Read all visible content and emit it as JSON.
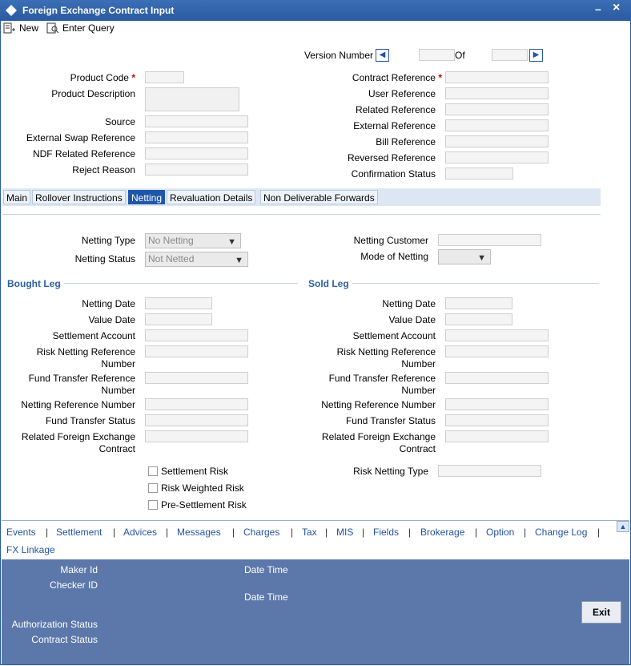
{
  "window": {
    "title": "Foreign Exchange Contract Input"
  },
  "toolbar": {
    "new_label": "New",
    "enter_query_label": "Enter Query"
  },
  "version": {
    "label": "Version Number",
    "of_label": "Of"
  },
  "header_left": {
    "product_code": "Product Code",
    "product_description": "Product Description",
    "source": "Source",
    "external_swap_reference": "External Swap Reference",
    "ndf_related_reference": "NDF Related Reference",
    "reject_reason": "Reject Reason"
  },
  "header_right": {
    "contract_reference": "Contract Reference",
    "user_reference": "User Reference",
    "related_reference": "Related Reference",
    "external_reference": "External Reference",
    "bill_reference": "Bill Reference",
    "reversed_reference": "Reversed Reference",
    "confirmation_status": "Confirmation Status"
  },
  "required_mark": "*",
  "tabs": [
    "Main",
    "Rollover Instructions",
    "Netting",
    "Revaluation Details",
    "Non Deliverable Forwards"
  ],
  "netting": {
    "netting_type_label": "Netting Type",
    "netting_type_value": "No Netting",
    "netting_status_label": "Netting Status",
    "netting_status_value": "Not Netted",
    "netting_customer_label": "Netting Customer",
    "mode_of_netting_label": "Mode of Netting"
  },
  "bought_leg": {
    "title": "Bought Leg",
    "netting_date": "Netting Date",
    "value_date": "Value Date",
    "settlement_account": "Settlement Account",
    "risk_netting_reference": "Risk Netting Reference",
    "risk_netting_reference_2": "Number",
    "fund_transfer_reference": "Fund Transfer Reference",
    "fund_transfer_reference_2": "Number",
    "netting_reference_number": "Netting Reference Number",
    "fund_transfer_status": "Fund Transfer Status",
    "related_fx_contract": "Related Foreign Exchange",
    "related_fx_contract_2": "Contract"
  },
  "sold_leg": {
    "title": "Sold Leg",
    "netting_date": "Netting Date",
    "value_date": "Value Date",
    "settlement_account": "Settlement Account",
    "risk_netting_reference": "Risk Netting Reference",
    "risk_netting_reference_2": "Number",
    "fund_transfer_reference": "Fund Transfer Reference",
    "fund_transfer_reference_2": "Number",
    "netting_reference_number": "Netting Reference Number",
    "fund_transfer_status": "Fund Transfer Status",
    "related_fx_contract": "Related Foreign Exchange",
    "related_fx_contract_2": "Contract"
  },
  "risk": {
    "settlement_risk": "Settlement Risk",
    "risk_weighted_risk": "Risk Weighted Risk",
    "pre_settlement_risk": "Pre-Settlement Risk",
    "risk_netting_type": "Risk Netting Type"
  },
  "links": [
    "Events",
    "Settlement",
    "Advices",
    "Messages",
    "Charges",
    "Tax",
    "MIS",
    "Fields",
    "Brokerage",
    "Option",
    "Change Log",
    "FX Linkage"
  ],
  "link_separator": "|",
  "footer": {
    "maker_id": "Maker Id",
    "checker_id": "Checker ID",
    "date_time": "Date Time",
    "authorization_status": "Authorization Status",
    "contract_status": "Contract Status",
    "exit_label": "Exit"
  },
  "colors": {
    "title_bar": "#2a5aa0",
    "footer": "#5c78ab",
    "active_tab": "#1f57a8",
    "section_title": "#2d5fa6"
  }
}
